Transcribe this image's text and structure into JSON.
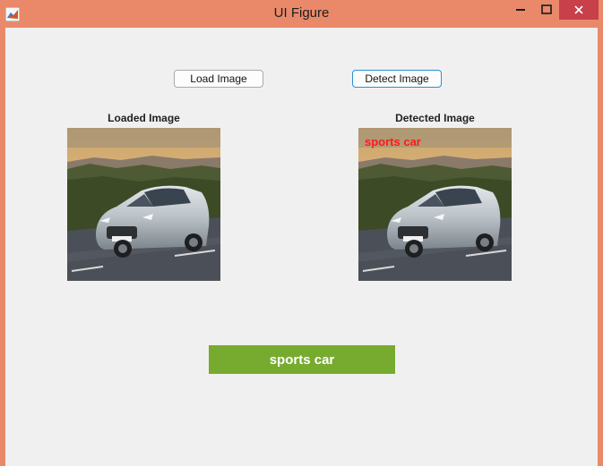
{
  "window": {
    "title": "UI Figure",
    "icon": "matlab-icon",
    "controls": [
      "minimize-icon",
      "maximize-icon",
      "close-icon"
    ]
  },
  "toolbar": {
    "load_label": "Load Image",
    "detect_label": "Detect Image"
  },
  "panels": {
    "loaded": {
      "title": "Loaded Image",
      "image": "car-photo"
    },
    "detected": {
      "title": "Detected Image",
      "image": "car-photo",
      "overlay_label": "sports car"
    }
  },
  "result": {
    "label": "sports car"
  },
  "colors": {
    "window_frame": "#e9896a",
    "close_button": "#c7404a",
    "client_bg": "#f0f0f0",
    "result_bg": "#77ab2f",
    "overlay_text": "#ff1a1a",
    "focus_border": "#2a8fd6"
  }
}
